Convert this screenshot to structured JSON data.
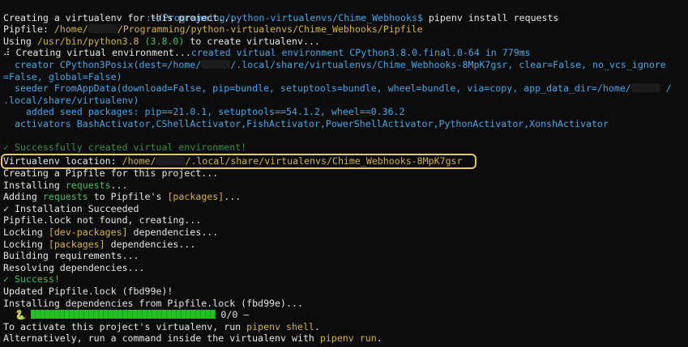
{
  "terminal": {
    "prompt_path": ":~/Programming/python-virtualenvs/Chime_Webhooks$",
    "command": " pipenv install requests",
    "l2": "Creating a virtualenv for this project...",
    "l3_a": "Pipfile: ",
    "l3_b": "/home/",
    "l3_c": "/Programming/python-virtualenvs/Chime_Webhooks/Pipfile",
    "l4_a": "Using ",
    "l4_b": "/usr/bin/python3.8",
    "l4_c": " (3.8.0)",
    "l4_d": " to create virtualenv...",
    "l5_a": "⠼ Creating virtual environment...",
    "l5_b": "created virtual environment CPython3.8.0.final.0-64 in 779ms",
    "l6_a": "  creator CPython3Posix(dest=/home/",
    "l6_b": "/.local/share/virtualenvs/Chime_Webhooks-8MpK7gsr, clear=False, no_vcs_ignore",
    "l7": "=False, global=False)",
    "l8_a": "  seeder FromAppData(download=False, pip=bundle, setuptools=bundle, wheel=bundle, via=copy, app_data_dir=/home/",
    "l8_b": " /",
    "l9": ".local/share/virtualenv)",
    "l10": "    added seed packages: pip==21.0.1, setuptools==54.1.2, wheel==0.36.2",
    "l11": "  activators BashActivator,CShellActivator,FishActivator,PowerShellActivator,PythonActivator,XonshActivator",
    "l12": "✓ Successfully created virtual environment!",
    "l13_a": "Virtualenv location: ",
    "l13_b": "/home/",
    "l13_c": "/.local/share/virtualenvs/Chime_Webhooks-8MpK7gsr",
    "l14": "Creating a Pipfile for this project...",
    "l15_a": "Installing ",
    "l15_b": "requests",
    "l15_c": "...",
    "l16_a": "Adding ",
    "l16_b": "requests",
    "l16_c": " to Pipfile's ",
    "l16_d": "[packages]",
    "l16_e": "...",
    "l17": "✓ Installation Succeeded",
    "l18": "Pipfile.lock not found, creating...",
    "l19_a": "Locking ",
    "l19_b": "[dev-packages]",
    "l19_c": " dependencies...",
    "l20_a": "Locking ",
    "l20_b": "[packages]",
    "l20_c": " dependencies...",
    "l21": "Building requirements...",
    "l22": "Resolving dependencies...",
    "l23": "✓ Success!",
    "l24": "Updated Pipfile.lock (fbd99e)!",
    "l25": "Installing dependencies from Pipfile.lock (fbd99e)...",
    "l26_spinner": "  🐍",
    "l26_count": "0/0 —",
    "l27_a": "To activate this project's virtualenv, run ",
    "l27_b": "pipenv shell",
    "l27_c": ".",
    "l28_a": "Alternatively, run a command inside the virtualenv with ",
    "l28_b": "pipenv run",
    "l28_c": ".",
    "install_progress_fraction": 1.0
  },
  "colors": {
    "background": "#0c0c0c",
    "green": "#4bbf5d",
    "blue": "#49a6e8",
    "yellow": "#d6b24a",
    "highlight_border": "#e9c66a"
  }
}
